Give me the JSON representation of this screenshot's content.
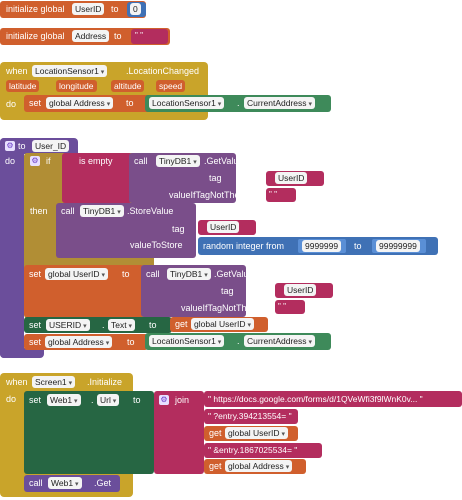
{
  "globals": [
    {
      "keyword": "initialize global",
      "name": "UserID",
      "to": "to",
      "value": "0"
    },
    {
      "keyword": "initialize global",
      "name": "Address",
      "to": "to",
      "value": "\" \""
    }
  ],
  "location_event": {
    "when": "when",
    "component": "LocationSensor1",
    "event": ".LocationChanged",
    "params": [
      "latitude",
      "longitude",
      "altitude",
      "speed"
    ],
    "do": "do",
    "set": "set",
    "var": "global Address",
    "to": "to",
    "source_component": "LocationSensor1",
    "property": "CurrentAddress"
  },
  "proc": {
    "to": "to",
    "name": "User_ID",
    "do": "do",
    "if": "if",
    "is_empty": "is empty",
    "call": "call",
    "db": "TinyDB1",
    "get_value": ".GetValue",
    "tag_label": "tag",
    "tag_value": "UserID",
    "vnt_label": "valueIfTagNotThere",
    "empty_text": "\" \"",
    "then": "then",
    "store_value": ".StoreValue",
    "value_to_store": "valueToStore",
    "random": "random integer from",
    "rand_from": "9999999",
    "rand_to_label": "to",
    "rand_to": "99999999",
    "set": "set",
    "global_userid": "global UserID",
    "label_comp": "USERID",
    "label_prop": "Text",
    "get": "get",
    "global_address": "global Address",
    "loc_comp": "LocationSensor1",
    "loc_prop": "CurrentAddress"
  },
  "screen_event": {
    "when": "when",
    "component": "Screen1",
    "event": ".Initialize",
    "do": "do",
    "set": "set",
    "web": "Web1",
    "url_prop": "Url",
    "to": "to",
    "join": "join",
    "parts": [
      "\" https://docs.google.com/forms/d/1QVeWfi3f9lWnK0v... \"",
      "\" ?entry.394213554= \"",
      "global UserID",
      "\" &entry.1867025534= \"",
      "global Address"
    ],
    "get": "get",
    "call": "call",
    "get_method": ".Get"
  }
}
